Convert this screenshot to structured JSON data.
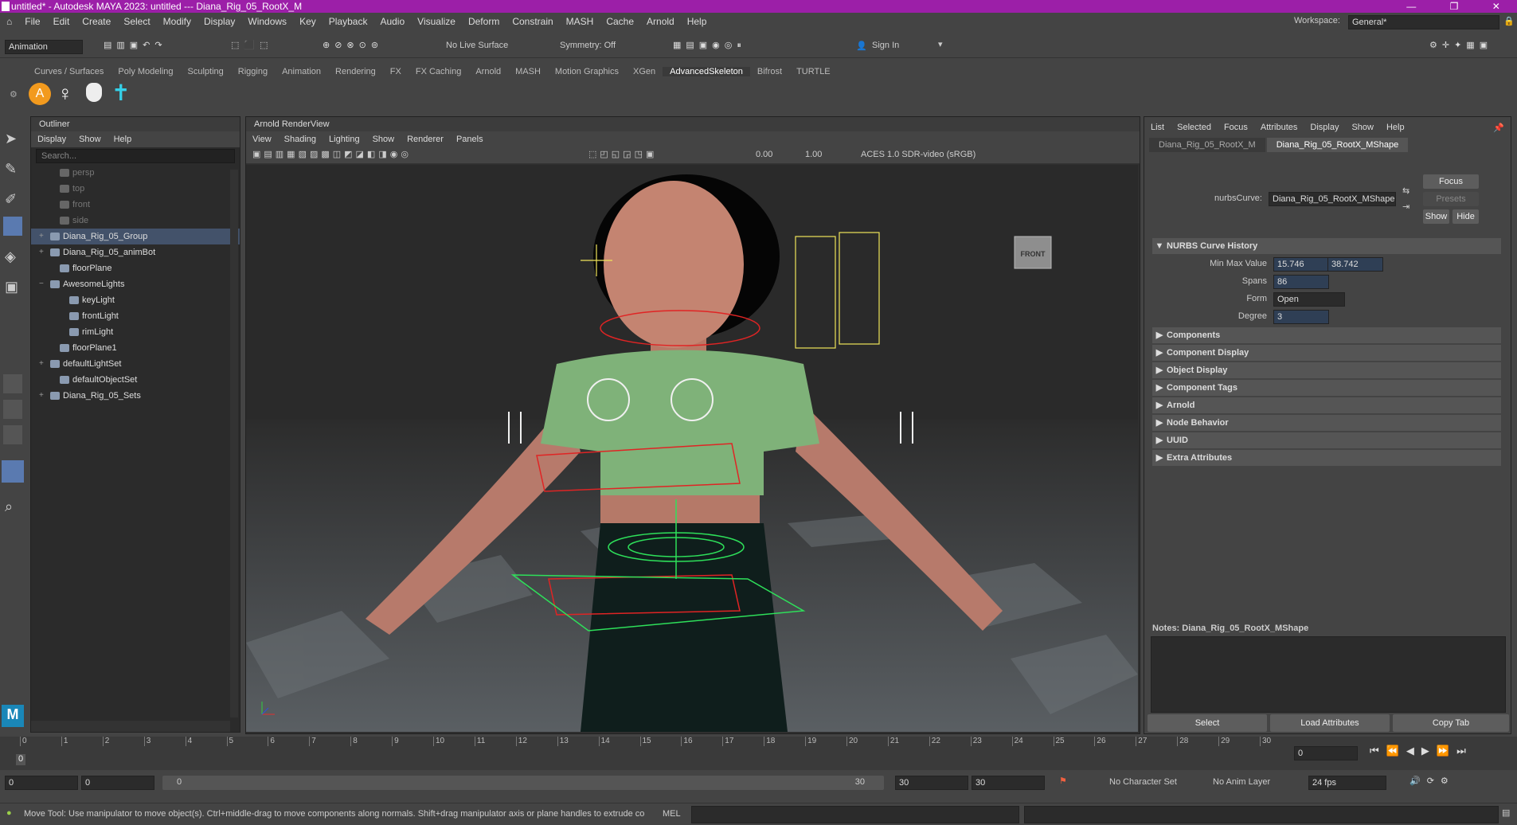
{
  "window": {
    "title": "untitled* - Autodesk MAYA 2023: untitled  ---  Diana_Rig_05_RootX_M"
  },
  "menu": [
    "File",
    "Edit",
    "Create",
    "Select",
    "Modify",
    "Display",
    "Windows",
    "Key",
    "Playback",
    "Audio",
    "Visualize",
    "Deform",
    "Constrain",
    "MASH",
    "Cache",
    "Arnold",
    "Help"
  ],
  "workspace": {
    "label": "Workspace:",
    "value": "General*"
  },
  "toolbar": {
    "mode": "Animation",
    "live_surface": "No Live Surface",
    "symmetry": "Symmetry: Off",
    "sign_in": "Sign In"
  },
  "shelf_tabs": [
    "Curves / Surfaces",
    "Poly Modeling",
    "Sculpting",
    "Rigging",
    "Animation",
    "Rendering",
    "FX",
    "FX Caching",
    "Arnold",
    "MASH",
    "Motion Graphics",
    "XGen",
    "AdvancedSkeleton",
    "Bifrost",
    "TURTLE"
  ],
  "shelf_active": "AdvancedSkeleton",
  "outliner": {
    "title": "Outliner",
    "menu": [
      "Display",
      "Show",
      "Help"
    ],
    "search_placeholder": "Search...",
    "items": [
      {
        "label": "persp",
        "dim": true,
        "indent": 1
      },
      {
        "label": "top",
        "dim": true,
        "indent": 1
      },
      {
        "label": "front",
        "dim": true,
        "indent": 1
      },
      {
        "label": "side",
        "dim": true,
        "indent": 1
      },
      {
        "label": "Diana_Rig_05_Group",
        "indent": 0,
        "expand": "+",
        "sel": true
      },
      {
        "label": "Diana_Rig_05_animBot",
        "indent": 0,
        "expand": "+"
      },
      {
        "label": "floorPlane",
        "indent": 1
      },
      {
        "label": "AwesomeLights",
        "indent": 0,
        "expand": "−"
      },
      {
        "label": "keyLight",
        "indent": 2
      },
      {
        "label": "frontLight",
        "indent": 2
      },
      {
        "label": "rimLight",
        "indent": 2
      },
      {
        "label": "floorPlane1",
        "indent": 1
      },
      {
        "label": "defaultLightSet",
        "indent": 0,
        "expand": "+"
      },
      {
        "label": "defaultObjectSet",
        "indent": 1
      },
      {
        "label": "Diana_Rig_05_Sets",
        "indent": 0,
        "expand": "+"
      }
    ]
  },
  "viewport": {
    "title": "Arnold RenderView",
    "menu": [
      "View",
      "Shading",
      "Lighting",
      "Show",
      "Renderer",
      "Panels"
    ],
    "exposure": "0.00",
    "gamma": "1.00",
    "color_space": "ACES 1.0 SDR-video (sRGB)",
    "view_cube": "FRONT"
  },
  "attr": {
    "menu": [
      "List",
      "Selected",
      "Focus",
      "Attributes",
      "Display",
      "Show",
      "Help"
    ],
    "tabs": [
      "Diana_Rig_05_RootX_M",
      "Diana_Rig_05_RootX_MShape"
    ],
    "node_label": "nurbsCurve:",
    "node_value": "Diana_Rig_05_RootX_MShape",
    "focus_btn": "Focus",
    "presets_btn": "Presets",
    "show_btn": "Show",
    "hide_btn": "Hide",
    "history_title": "NURBS Curve History",
    "min_max_label": "Min Max Value",
    "min_val": "15.746",
    "max_val": "38.742",
    "spans_label": "Spans",
    "spans_val": "86",
    "form_label": "Form",
    "form_val": "Open",
    "degree_label": "Degree",
    "degree_val": "3",
    "sections": [
      "Components",
      "Component Display",
      "Object Display",
      "Component Tags",
      "Arnold",
      "Node Behavior",
      "UUID",
      "Extra Attributes"
    ],
    "notes": "Notes:  Diana_Rig_05_RootX_MShape",
    "select_btn": "Select",
    "load_btn": "Load Attributes",
    "copy_btn": "Copy Tab"
  },
  "timeline": {
    "ticks": [
      "0",
      "1",
      "2",
      "3",
      "4",
      "5",
      "6",
      "7",
      "8",
      "9",
      "10",
      "11",
      "12",
      "13",
      "14",
      "15",
      "16",
      "17",
      "18",
      "19",
      "20",
      "21",
      "22",
      "23",
      "24",
      "25",
      "26",
      "27",
      "28",
      "29",
      "30"
    ],
    "current": "0",
    "current_field": "0"
  },
  "range": {
    "start": "0",
    "anim_start": "0",
    "slider_start": "0",
    "slider_end": "30",
    "anim_end": "30",
    "end": "30",
    "character_set": "No Character Set",
    "anim_layer": "No Anim Layer",
    "fps": "24 fps"
  },
  "status": {
    "message": "Move Tool: Use manipulator to move object(s). Ctrl+middle-drag to move components along normals. Shift+drag manipulator axis or plane handles to extrude components or c",
    "lang": "MEL"
  },
  "colors": {
    "title_bar": "#9c1fa8",
    "selection": "#43526a",
    "shirt": "#7fb279"
  }
}
